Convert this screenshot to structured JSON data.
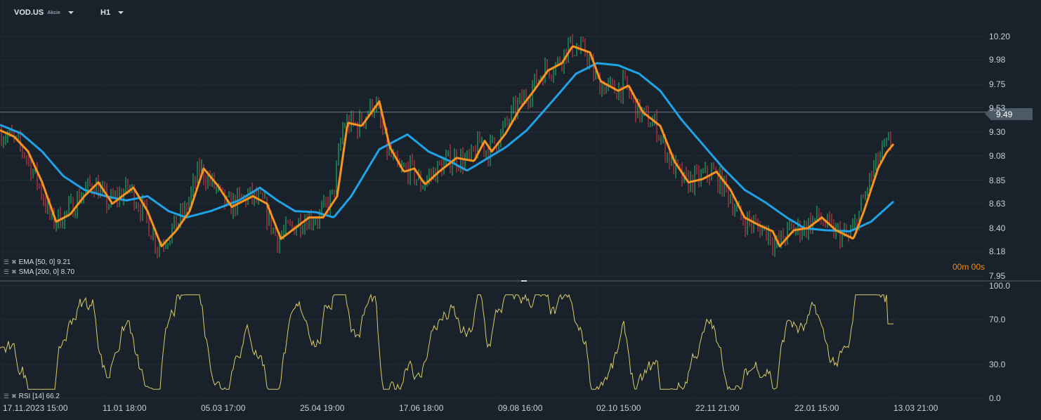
{
  "header": {
    "symbol": "VOD.US",
    "type": "Akcie",
    "timeframe": "H1"
  },
  "current_price": "9.49",
  "countdown": "00m 00s",
  "legends": {
    "ema": "EMA [50, 0] 9.21",
    "sma": "SMA [200, 0] 8.70",
    "rsi": "RSI [14] 66.2"
  },
  "colors": {
    "ema": "#f7931e",
    "sma": "#1ea3e6",
    "rsi": "#d9cc6a",
    "up": "#1fc46b",
    "down": "#e8394a",
    "bg": "#19212a"
  },
  "chart_data": {
    "type": "line",
    "price_ticks": [
      "10.20",
      "9.98",
      "9.75",
      "9.53",
      "9.30",
      "9.08",
      "8.85",
      "8.63",
      "8.40",
      "8.18",
      "7.95"
    ],
    "price_range": [
      7.95,
      10.2
    ],
    "rsi_ticks": [
      "100.0",
      "70.0",
      "30.0",
      "0.0"
    ],
    "rsi_range": [
      0,
      100
    ],
    "x_labels": [
      "17.11.2023 15:00",
      "11.01 18:00",
      "05.03 17:00",
      "25.04 19:00",
      "17.06 18:00",
      "09.08 16:00",
      "02.10 15:00",
      "22.11 21:00",
      "22.01 15:00",
      "13.03 21:00"
    ],
    "x_range_bars": [
      0,
      1400
    ],
    "series": [
      {
        "name": "EMA 50",
        "last": 9.21,
        "bars": [
          0,
          20,
          40,
          60,
          80,
          100,
          120,
          140,
          160,
          190,
          210,
          230,
          250,
          270,
          290,
          310,
          330,
          360,
          380,
          400,
          420,
          440,
          460,
          480,
          495,
          515,
          540,
          555,
          575,
          590,
          605,
          625,
          650,
          675,
          690,
          700,
          720,
          740,
          760,
          780,
          800,
          815,
          840,
          855,
          880,
          895,
          915,
          940,
          960,
          980,
          1000,
          1020,
          1040,
          1060,
          1080,
          1100,
          1110,
          1130,
          1150,
          1170,
          1190,
          1215,
          1230,
          1250,
          1262,
          1272
        ],
        "values": [
          9.32,
          9.26,
          9.12,
          8.83,
          8.46,
          8.53,
          8.7,
          8.83,
          8.63,
          8.78,
          8.56,
          8.23,
          8.37,
          8.56,
          8.96,
          8.8,
          8.6,
          8.7,
          8.63,
          8.3,
          8.4,
          8.5,
          8.5,
          8.7,
          9.39,
          9.36,
          9.59,
          9.16,
          8.93,
          8.96,
          8.81,
          8.93,
          9.06,
          9.03,
          9.22,
          9.12,
          9.29,
          9.52,
          9.69,
          9.88,
          9.95,
          10.11,
          10.05,
          9.78,
          9.69,
          9.74,
          9.49,
          9.36,
          9.03,
          8.83,
          8.86,
          8.93,
          8.76,
          8.5,
          8.43,
          8.37,
          8.23,
          8.38,
          8.4,
          8.5,
          8.38,
          8.3,
          8.56,
          8.96,
          9.11,
          9.19
        ]
      },
      {
        "name": "SMA 200",
        "last": 8.7,
        "bars": [
          0,
          30,
          60,
          90,
          120,
          150,
          180,
          210,
          240,
          265,
          300,
          340,
          370,
          395,
          420,
          450,
          475,
          500,
          540,
          580,
          610,
          640,
          665,
          690,
          720,
          750,
          790,
          820,
          850,
          880,
          910,
          940,
          970,
          1000,
          1030,
          1060,
          1090,
          1120,
          1145,
          1175,
          1210,
          1240,
          1272
        ],
        "values": [
          9.37,
          9.29,
          9.12,
          8.89,
          8.76,
          8.7,
          8.66,
          8.7,
          8.56,
          8.5,
          8.56,
          8.66,
          8.78,
          8.66,
          8.56,
          8.55,
          8.5,
          8.7,
          9.14,
          9.28,
          9.12,
          9.03,
          8.94,
          9.04,
          9.16,
          9.32,
          9.62,
          9.85,
          9.95,
          9.93,
          9.85,
          9.69,
          9.42,
          9.19,
          8.96,
          8.76,
          8.64,
          8.5,
          8.4,
          8.38,
          8.37,
          8.46,
          8.65
        ]
      },
      {
        "name": "RSI 14",
        "last": 66.2
      }
    ]
  }
}
